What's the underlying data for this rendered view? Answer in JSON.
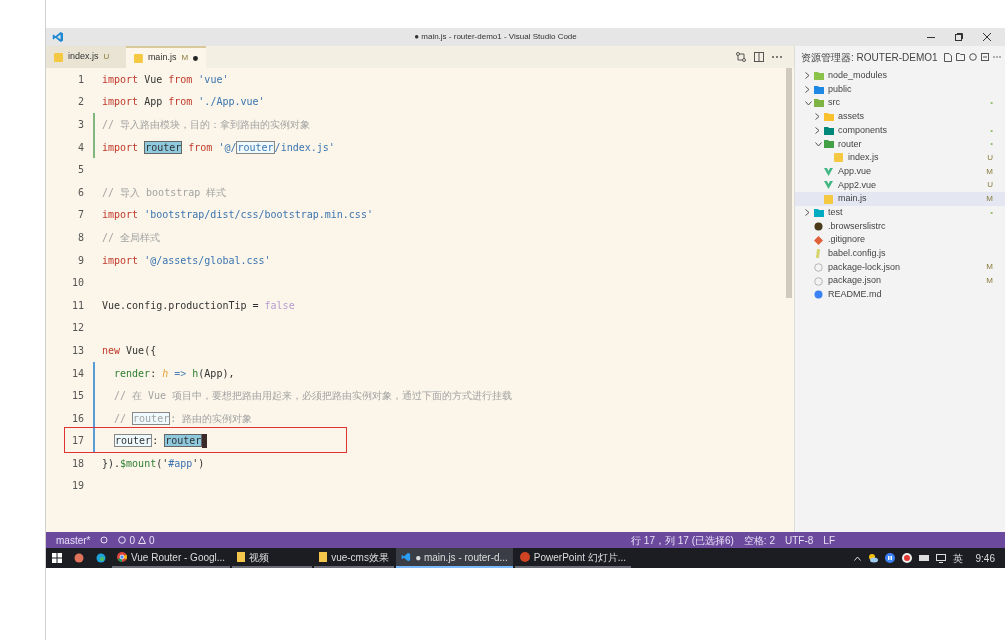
{
  "window": {
    "title": "● main.js - router-demo1 - Visual Studio Code"
  },
  "tabs": [
    {
      "label": "index.js",
      "badge": "U",
      "selected": false,
      "dirty": false
    },
    {
      "label": "main.js",
      "badge": "M",
      "selected": true,
      "dirty": true
    }
  ],
  "editor": {
    "lines": [
      {
        "number": "1",
        "added": false,
        "modified": false,
        "indented": false,
        "boxed": false,
        "tokens": [
          {
            "text": "import",
            "kind": "keyword"
          },
          {
            "text": " Vue ",
            "kind": "plain"
          },
          {
            "text": "from",
            "kind": "keyword"
          },
          {
            "text": " 'vue'",
            "kind": "string"
          }
        ]
      },
      {
        "number": "2",
        "added": false,
        "modified": false,
        "indented": false,
        "boxed": false,
        "tokens": [
          {
            "text": "import",
            "kind": "keyword"
          },
          {
            "text": " App ",
            "kind": "plain"
          },
          {
            "text": "from",
            "kind": "keyword"
          },
          {
            "text": " './App.vue'",
            "kind": "string"
          }
        ]
      },
      {
        "number": "3",
        "added": true,
        "modified": false,
        "indented": false,
        "boxed": false,
        "tokens": [
          {
            "text": "// 导入路由模块，目的：拿到路由的实例对象",
            "kind": "comment"
          }
        ]
      },
      {
        "number": "4",
        "added": true,
        "modified": false,
        "indented": false,
        "boxed": false,
        "tokens": [
          {
            "text": "import ",
            "kind": "keyword"
          },
          {
            "text": "router",
            "kind": "plain",
            "selection": true
          },
          {
            "text": " from",
            "kind": "keyword"
          },
          {
            "text": " '@/",
            "kind": "string"
          },
          {
            "text": "router",
            "kind": "string",
            "occurrence": true
          },
          {
            "text": "/index.js'",
            "kind": "string"
          }
        ]
      },
      {
        "number": "5",
        "added": false,
        "modified": false,
        "boxed": false
      },
      {
        "number": "6",
        "added": false,
        "modified": false,
        "indented": false,
        "boxed": false,
        "tokens": [
          {
            "text": "// 导入 bootstrap 样式",
            "kind": "comment"
          }
        ]
      },
      {
        "number": "7",
        "added": false,
        "modified": false,
        "indented": false,
        "boxed": false,
        "tokens": [
          {
            "text": "import",
            "kind": "keyword"
          },
          {
            "text": " 'bootstrap/dist/css/bootstrap.min.css'",
            "kind": "string"
          }
        ]
      },
      {
        "number": "8",
        "added": false,
        "modified": false,
        "indented": false,
        "boxed": false,
        "tokens": [
          {
            "text": "// 全局样式",
            "kind": "comment"
          }
        ]
      },
      {
        "number": "9",
        "added": false,
        "modified": false,
        "indented": false,
        "boxed": false,
        "tokens": [
          {
            "text": "import",
            "kind": "keyword"
          },
          {
            "text": " '@/assets/global.css'",
            "kind": "string"
          }
        ]
      },
      {
        "number": "10",
        "added": false,
        "modified": false,
        "boxed": false
      },
      {
        "number": "11",
        "added": false,
        "modified": false,
        "indented": false,
        "boxed": false,
        "tokens": [
          {
            "text": "Vue.config.productionTip = ",
            "kind": "plain"
          },
          {
            "text": "false",
            "kind": "constant"
          }
        ]
      },
      {
        "number": "12",
        "added": false,
        "modified": false,
        "boxed": false
      },
      {
        "number": "13",
        "added": false,
        "modified": false,
        "indented": false,
        "boxed": false,
        "tokens": [
          {
            "text": "new",
            "kind": "keyword"
          },
          {
            "text": " Vue({",
            "kind": "plain"
          }
        ]
      },
      {
        "number": "14",
        "added": false,
        "modified": true,
        "indented": true,
        "boxed": false,
        "tokens": [
          {
            "text": "render",
            "kind": "property"
          },
          {
            "text": ": ",
            "kind": "plain"
          },
          {
            "text": "h",
            "kind": "param"
          },
          {
            "text": " => ",
            "kind": "operator"
          },
          {
            "text": "h",
            "kind": "property"
          },
          {
            "text": "(App),",
            "kind": "plain"
          }
        ]
      },
      {
        "number": "15",
        "added": false,
        "modified": true,
        "indented": true,
        "boxed": false,
        "tokens": [
          {
            "text": "// 在 Vue 项目中，要想把路由用起来，必须把路由实例对象，通过下面的方式进行挂载",
            "kind": "comment"
          }
        ]
      },
      {
        "number": "16",
        "added": false,
        "modified": true,
        "indented": true,
        "boxed": false,
        "tokens": [
          {
            "text": "// ",
            "kind": "comment"
          },
          {
            "text": "router",
            "kind": "comment",
            "occurrence": true
          },
          {
            "text": ": 路由的实例对象",
            "kind": "comment"
          }
        ]
      },
      {
        "number": "17",
        "added": false,
        "modified": true,
        "indented": true,
        "boxed": true,
        "tokens": [
          {
            "text": "router",
            "kind": "plain",
            "occurrence": true
          },
          {
            "text": ": ",
            "kind": "plain"
          },
          {
            "text": "router",
            "kind": "plain",
            "selection": true
          }
        ]
      },
      {
        "number": "18",
        "added": false,
        "modified": false,
        "indented": false,
        "boxed": false,
        "tokens": [
          {
            "text": "}).",
            "kind": "plain"
          },
          {
            "text": "$mount",
            "kind": "property"
          },
          {
            "text": "('",
            "kind": "plain"
          },
          {
            "text": "#app",
            "kind": "string"
          },
          {
            "text": "')",
            "kind": "plain"
          }
        ]
      },
      {
        "number": "19",
        "added": false,
        "modified": false,
        "boxed": false
      }
    ]
  },
  "explorer": {
    "title": "资源管理器: ROUTER-DEMO1",
    "items": [
      {
        "label": "node_modules",
        "kind": "folder",
        "expanded": false,
        "selected": false,
        "color": "#8bc34a"
      },
      {
        "label": "public",
        "kind": "folder",
        "expanded": false,
        "selected": false,
        "color": "#1e88e5"
      },
      {
        "label": "src",
        "kind": "folder",
        "expanded": true,
        "selected": false,
        "status": "•",
        "color": "#7cb342",
        "children": [
          {
            "label": "assets",
            "kind": "folder",
            "expanded": false,
            "selected": false,
            "color": "#fbc02d"
          },
          {
            "label": "components",
            "kind": "folder",
            "expanded": false,
            "selected": false,
            "status": "•",
            "color": "#00897b"
          },
          {
            "label": "router",
            "kind": "folder",
            "expanded": true,
            "selected": false,
            "status": "•",
            "color": "#43a047",
            "children": [
              {
                "label": "index.js",
                "kind": "js",
                "selected": false,
                "status": "U"
              }
            ]
          },
          {
            "label": "App.vue",
            "kind": "vue",
            "selected": false,
            "status": "M"
          },
          {
            "label": "App2.vue",
            "kind": "vue",
            "selected": false,
            "status": "U"
          },
          {
            "label": "main.js",
            "kind": "js",
            "selected": true,
            "status": "M"
          }
        ]
      },
      {
        "label": "test",
        "kind": "folder",
        "expanded": false,
        "selected": false,
        "status": "•",
        "color": "#00acc1"
      },
      {
        "label": ".browserslistrc",
        "kind": "config",
        "selected": false
      },
      {
        "label": ".gitignore",
        "kind": "git",
        "selected": false
      },
      {
        "label": "babel.config.js",
        "kind": "babel",
        "selected": false
      },
      {
        "label": "package-lock.json",
        "kind": "json",
        "selected": false,
        "status": "M"
      },
      {
        "label": "package.json",
        "kind": "json",
        "selected": false,
        "status": "M"
      },
      {
        "label": "README.md",
        "kind": "info",
        "selected": false
      }
    ]
  },
  "status_bar": {
    "branch": "master*",
    "errors": "0",
    "warnings": "0",
    "right": [
      "行 17，列 17 (已选择6)",
      "空格: 2",
      "UTF-8",
      "LF"
    ]
  },
  "taskbar": {
    "apps": [
      {
        "label": "Vue Router - Googl...",
        "kind": "chrome",
        "selected": false
      },
      {
        "label": "视频",
        "kind": "folder",
        "selected": false
      },
      {
        "label": "vue-cms效果",
        "kind": "folder",
        "selected": false
      },
      {
        "label": "● main.js - router-d...",
        "kind": "vscode",
        "selected": true
      },
      {
        "label": "PowerPoint 幻灯片...",
        "kind": "powerpoint",
        "selected": false
      }
    ],
    "ime": "英",
    "time": "9:46"
  }
}
